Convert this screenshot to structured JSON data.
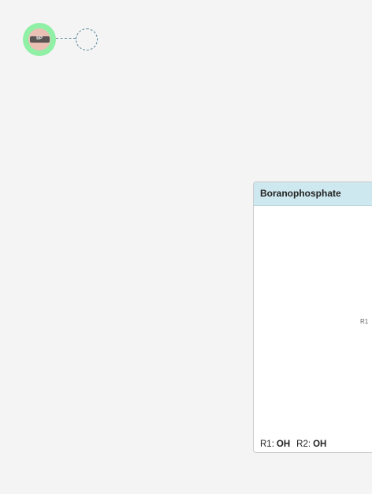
{
  "monomer": {
    "label": "bP",
    "ring_color": "#8ff0a6",
    "inner_color": "#ebc0b4"
  },
  "card": {
    "title": "Boranophosphate",
    "header_color": "#cde8ee",
    "structure_label": "R1",
    "r1_label": "R1:",
    "r1_value": "OH",
    "r2_label": "R2:",
    "r2_value": "OH"
  }
}
